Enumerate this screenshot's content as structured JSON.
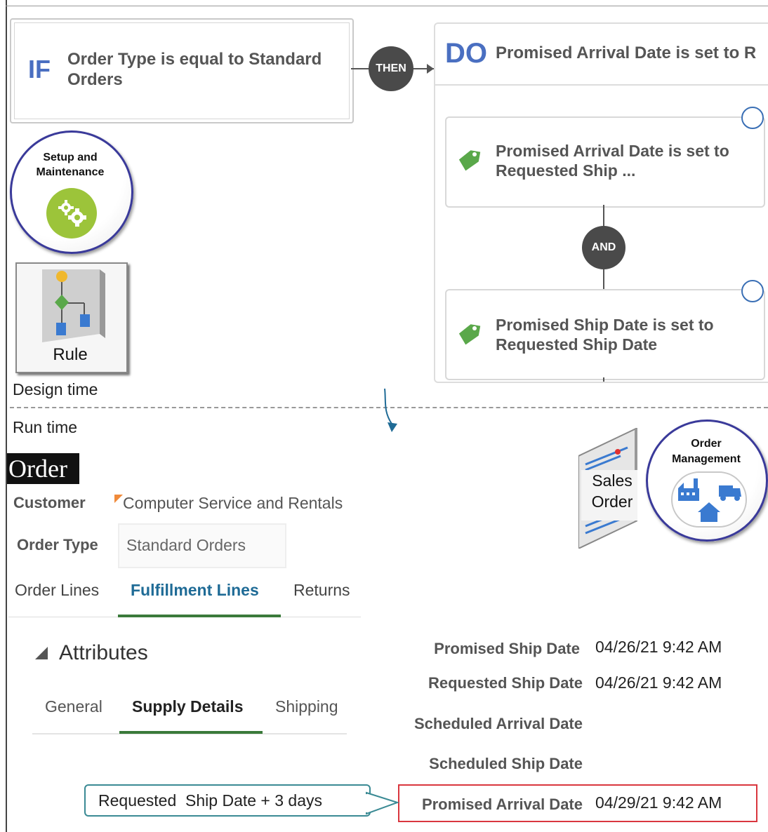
{
  "rule": {
    "if_keyword": "IF",
    "condition": "Order Type is equal to Standard Orders",
    "then_label": "THEN",
    "do_keyword": "DO",
    "do_summary": "Promised Arrival Date is set to R",
    "actions": [
      {
        "text": "Promised Arrival Date is set to Requested Ship ..."
      },
      {
        "text": "Promised Ship Date is set to Requested Ship Date"
      }
    ],
    "and_label": "AND"
  },
  "setup": {
    "label": "Setup and Maintenance"
  },
  "rule_tile": {
    "label": "Rule"
  },
  "sections": {
    "design_time": "Design time",
    "run_time": "Run time"
  },
  "order": {
    "title": "Order",
    "customer_label": "Customer",
    "customer_value": "Computer Service and Rentals",
    "order_type_label": "Order Type",
    "order_type_value": "Standard Orders",
    "tabs": [
      "Order Lines",
      "Fulfillment Lines",
      "Returns"
    ],
    "active_tab": "Fulfillment Lines"
  },
  "attributes": {
    "heading": "Attributes",
    "subtabs": [
      "General",
      "Supply Details",
      "Shipping"
    ],
    "active_subtab": "Supply Details"
  },
  "dates": [
    {
      "label": "Promised Ship Date",
      "value": "04/26/21 9:42 AM"
    },
    {
      "label": "Requested Ship Date",
      "value": "04/26/21 9:42 AM"
    },
    {
      "label": "Scheduled Arrival Date",
      "value": ""
    },
    {
      "label": "Scheduled Ship Date",
      "value": ""
    },
    {
      "label": "Promised Arrival Date",
      "value": "04/29/21 9:42 AM"
    }
  ],
  "callout": "Requested  Ship Date + 3 days",
  "sales_order": {
    "label_line1": "Sales",
    "label_line2": "Order"
  },
  "order_management": {
    "label": "Order Management"
  },
  "colors": {
    "accent_blue": "#4a6fc1",
    "tag_green": "#5aa84a",
    "highlight_red": "#d9363e",
    "callout_teal": "#3a8a94",
    "tab_green": "#3a7a3a"
  }
}
